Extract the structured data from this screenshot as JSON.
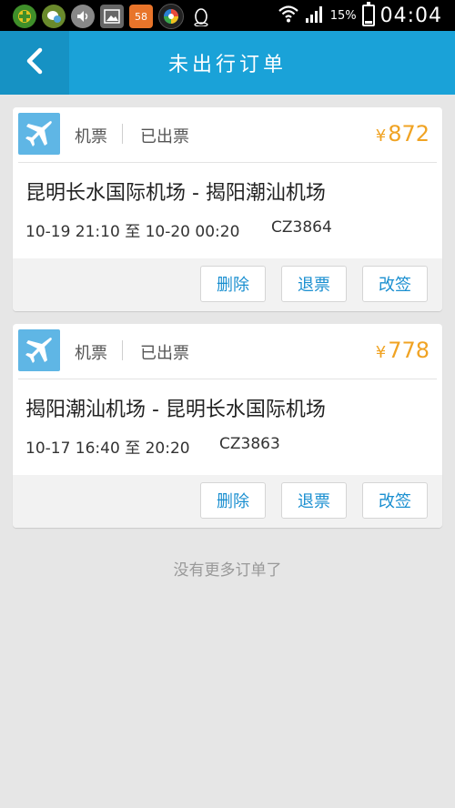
{
  "status_bar": {
    "app_badge": "58",
    "battery_percent": "15%",
    "battery_level": 0.15,
    "time": "04:04"
  },
  "header": {
    "title": "未出行订单"
  },
  "orders": [
    {
      "category": "机票",
      "status": "已出票",
      "currency": "¥",
      "price": "872",
      "route": "昆明长水国际机场 - 揭阳潮汕机场",
      "time": "10-19 21:10 至 10-20 00:20",
      "flight_no": "CZ3864",
      "actions": {
        "delete": "删除",
        "refund": "退票",
        "change": "改签"
      }
    },
    {
      "category": "机票",
      "status": "已出票",
      "currency": "¥",
      "price": "778",
      "route": "揭阳潮汕机场 - 昆明长水国际机场",
      "time": "10-17 16:40 至 20:20",
      "flight_no": "CZ3863",
      "actions": {
        "delete": "删除",
        "refund": "退票",
        "change": "改签"
      }
    }
  ],
  "footer": {
    "no_more": "没有更多订单了"
  },
  "colors": {
    "header_bg": "#1aa2d8",
    "price": "#f0a323",
    "button_text": "#1a8fd0",
    "plane_icon_bg": "#5fb6e5"
  }
}
